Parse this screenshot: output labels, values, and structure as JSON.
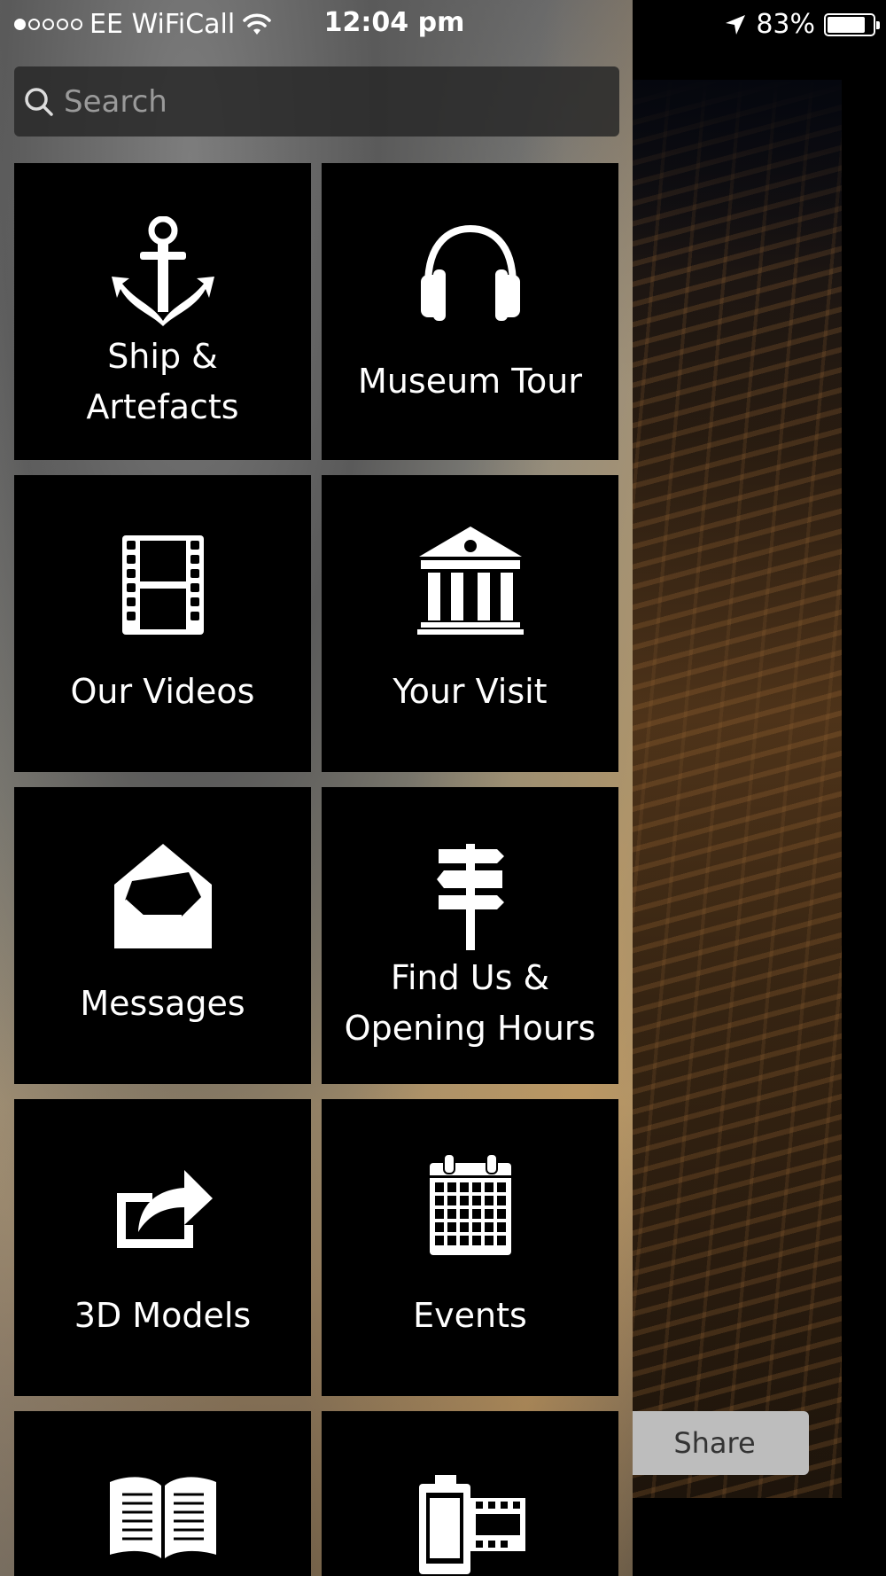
{
  "status_bar": {
    "carrier": "EE WiFiCall",
    "time": "12:04 pm",
    "battery": "83%",
    "battery_level": 0.83
  },
  "search": {
    "placeholder": "Search"
  },
  "menu": {
    "items": [
      {
        "label_line1": "Ship &",
        "label_line2": "Artefacts",
        "icon": "anchor-icon"
      },
      {
        "label": "Museum Tour",
        "icon": "headphones-icon"
      },
      {
        "label": "Our Videos",
        "icon": "film-icon"
      },
      {
        "label": "Your Visit",
        "icon": "museum-building-icon"
      },
      {
        "label": "Messages",
        "icon": "envelope-icon"
      },
      {
        "label_line1": "Find Us &",
        "label_line2": "Opening Hours",
        "icon": "signpost-icon"
      },
      {
        "label": "3D Models",
        "icon": "share-arrow-icon"
      },
      {
        "label": "Events",
        "icon": "calendar-icon"
      },
      {
        "label": "",
        "icon": "open-book-icon"
      },
      {
        "label": "",
        "icon": "film-roll-icon"
      }
    ]
  },
  "background": {
    "share_label": "Share"
  }
}
